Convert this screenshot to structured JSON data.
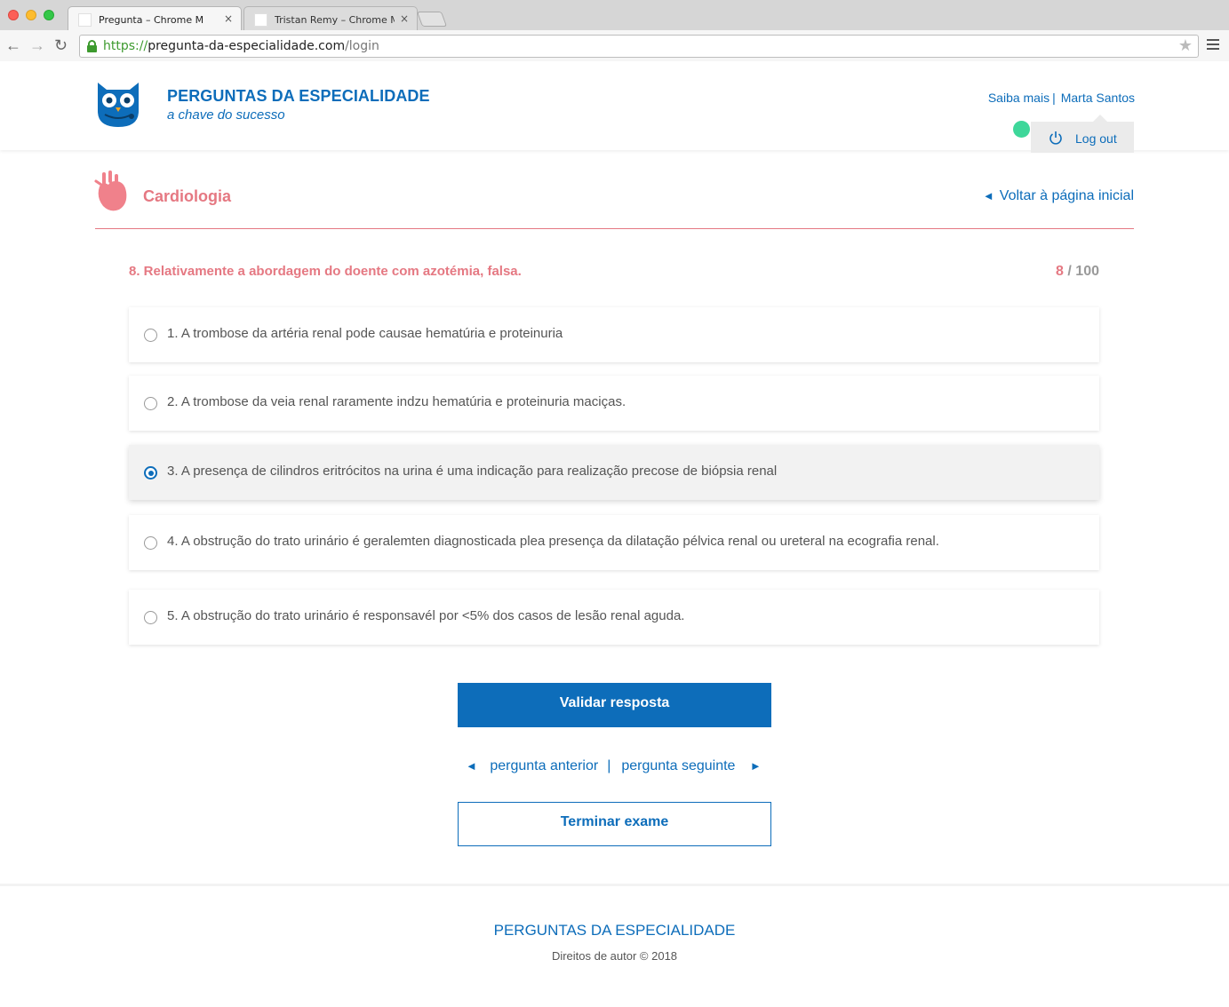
{
  "browser": {
    "tabs": [
      {
        "title": "Pregunta – Chrome M",
        "close": "×"
      },
      {
        "title": "Tristan Remy – Chrome M",
        "close": "×"
      }
    ],
    "url": {
      "scheme": "https://",
      "host": "pregunta-da-especialidade.com",
      "path": "/login"
    },
    "icons": [
      "back-arrow-icon",
      "forward-arrow-icon",
      "reload-icon",
      "lock-icon",
      "star-icon",
      "menu-icon"
    ]
  },
  "header": {
    "title": "PERGUNTAS DA ESPECIALIDADE",
    "tagline": "a chave do sucesso",
    "links": {
      "about": "Saiba mais",
      "separator": "|",
      "user": "Marta Santos"
    },
    "logout": "Log out"
  },
  "section": {
    "title": "Cardiologia",
    "back_link": "Voltar à página inicial",
    "back_arrow": "◄"
  },
  "question": {
    "text": "8. Relativamente a abordagem do doente com azotémia, falsa.",
    "current": "8",
    "separator": " / ",
    "total": "100"
  },
  "options": [
    {
      "label": "1. A trombose da artéria renal pode causae hematúria e proteinuria",
      "selected": false
    },
    {
      "label": "2. A trombose da veia renal raramente indzu hematúria e proteinuria maciças.",
      "selected": false
    },
    {
      "label": "3. A presença de cilindros eritrócitos na urina é uma indicação para realização precose de biópsia renal",
      "selected": true
    },
    {
      "label": "4. A obstrução do trato urinário é geralemten diagnosticada plea presença da dilatação pélvica renal ou ureteral na ecografia renal.",
      "selected": false
    },
    {
      "label": "5. A obstrução do trato urinário é responsavél por <5% dos casos de lesão renal aguda.",
      "selected": false
    }
  ],
  "actions": {
    "validate": "Validar resposta",
    "prev": "pergunta anterior",
    "next": "pergunta seguinte",
    "pager_separator": "|",
    "prev_arrow": "◄",
    "next_arrow": "►",
    "finish": "Terminar exame"
  },
  "footer": {
    "title": "PERGUNTAS DA ESPECIALIDADE",
    "copyright": "Direitos de autor © 2018"
  },
  "colors": {
    "brand_blue": "#0d6dba",
    "accent_pink": "#e57882",
    "online_green": "#3ed79a"
  }
}
